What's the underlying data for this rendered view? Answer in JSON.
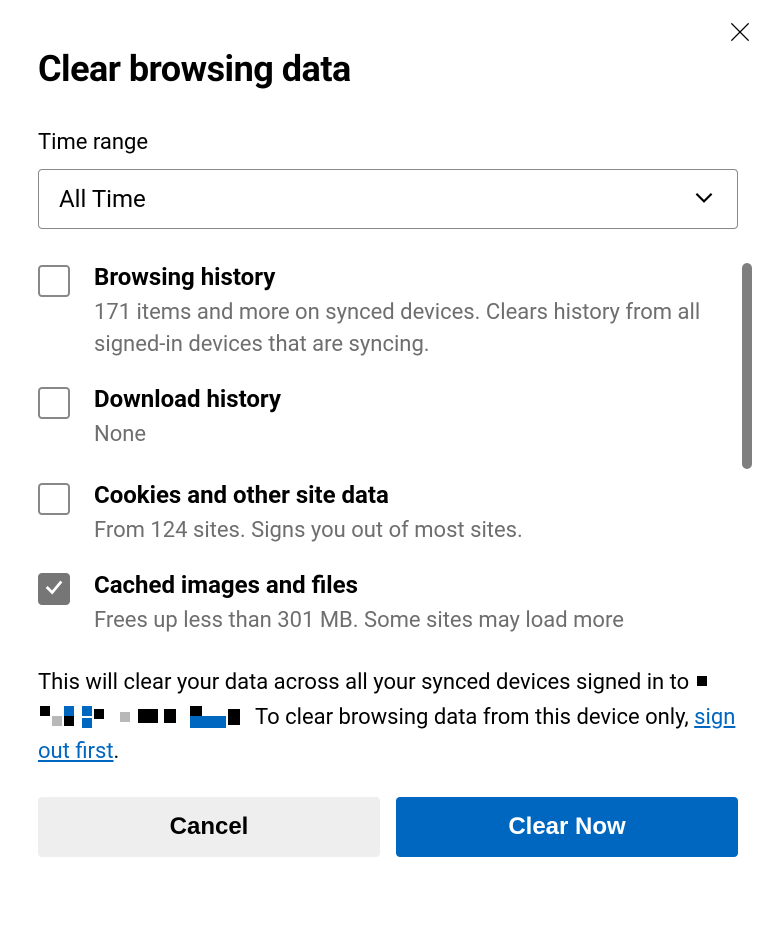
{
  "dialog": {
    "title": "Clear browsing data",
    "time_range_label": "Time range",
    "time_range_value": "All Time"
  },
  "options": [
    {
      "title": "Browsing history",
      "desc": "171 items and more on synced devices. Clears history from all signed-in devices that are syncing.",
      "checked": false
    },
    {
      "title": "Download history",
      "desc": "None",
      "checked": false
    },
    {
      "title": "Cookies and other site data",
      "desc": "From 124 sites. Signs you out of most sites.",
      "checked": false
    },
    {
      "title": "Cached images and files",
      "desc": "Frees up less than 301 MB. Some sites may load more",
      "checked": true
    }
  ],
  "footer": {
    "prefix": "This will clear your data across all your synced devices signed in to ",
    "after_redaction": " To clear browsing data from this device only, ",
    "link": "sign out first",
    "period": "."
  },
  "buttons": {
    "cancel": "Cancel",
    "confirm": "Clear Now"
  }
}
